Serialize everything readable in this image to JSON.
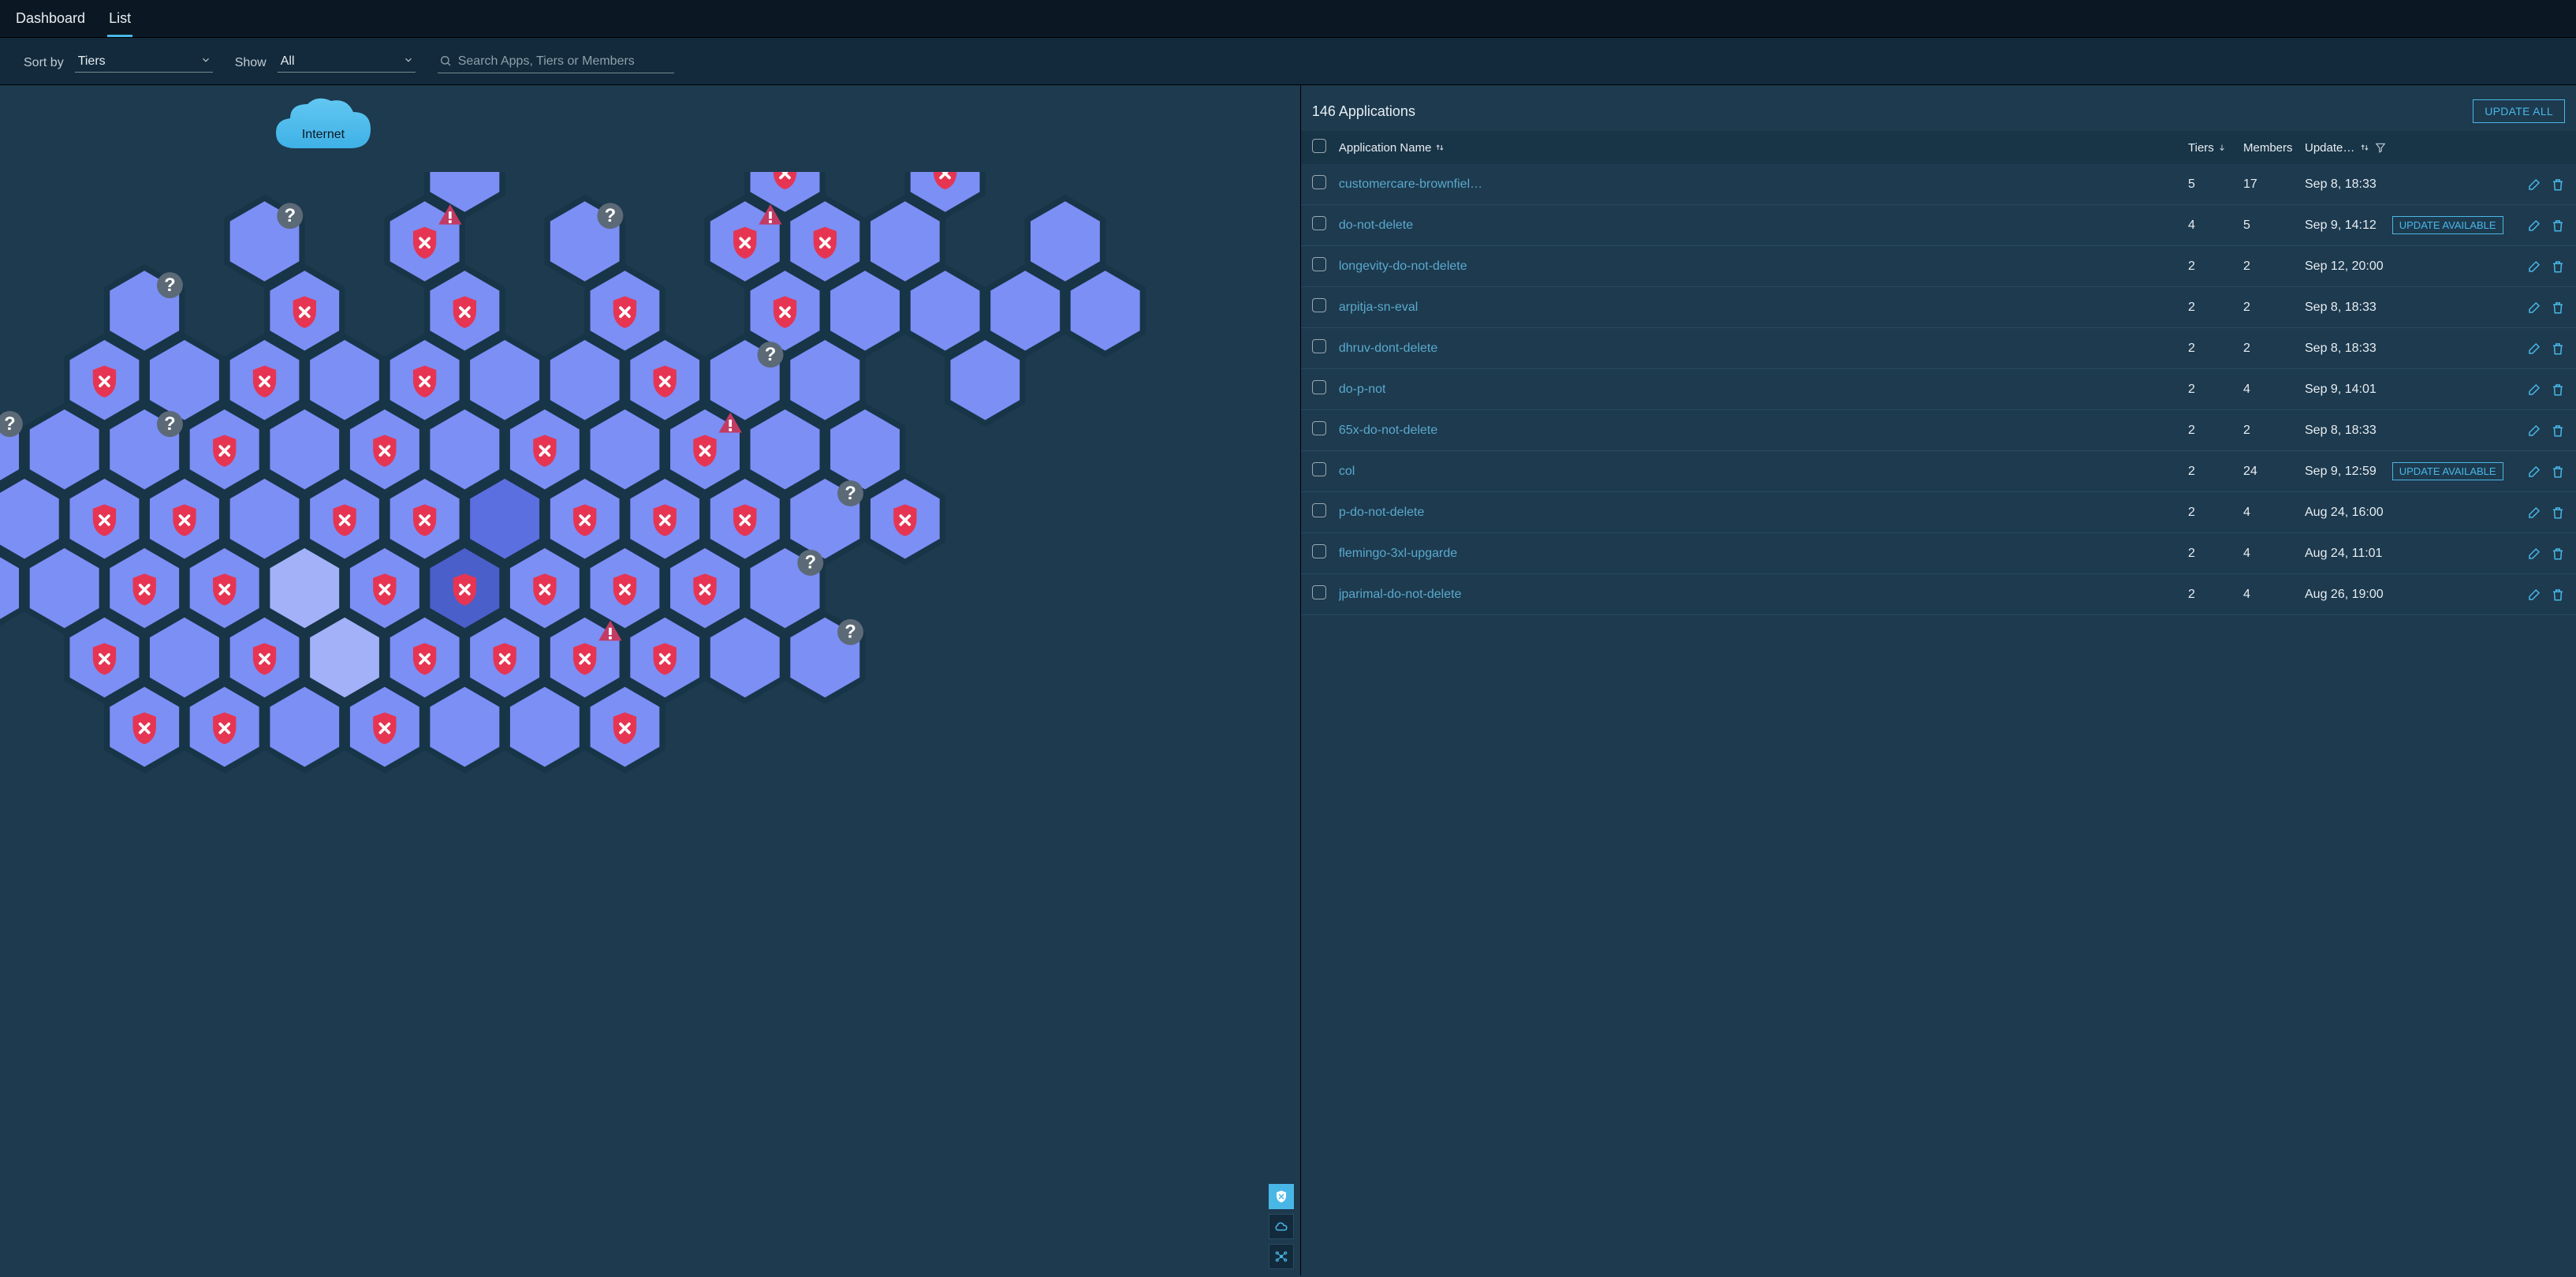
{
  "tabs": {
    "dashboard": "Dashboard",
    "list": "List",
    "active": "list"
  },
  "filters": {
    "sort_label": "Sort by",
    "sort_value": "Tiers",
    "show_label": "Show",
    "show_value": "All",
    "search_placeholder": "Search Apps, Tiers or Members"
  },
  "summary": {
    "title": "146 Applications",
    "update_all": "UPDATE ALL"
  },
  "columns": {
    "name": "Application Name",
    "tiers": "Tiers",
    "members": "Members",
    "updated": "Update…"
  },
  "update_available_label": "UPDATE AVAILABLE",
  "apps": [
    {
      "name": "customercare-brownfiel…",
      "tiers": "5",
      "members": "17",
      "updated": "Sep 8, 18:33",
      "update_available": false
    },
    {
      "name": "do-not-delete",
      "tiers": "4",
      "members": "5",
      "updated": "Sep 9, 14:12",
      "update_available": true
    },
    {
      "name": "longevity-do-not-delete",
      "tiers": "2",
      "members": "2",
      "updated": "Sep 12, 20:00",
      "update_available": false
    },
    {
      "name": "arpitja-sn-eval",
      "tiers": "2",
      "members": "2",
      "updated": "Sep 8, 18:33",
      "update_available": false
    },
    {
      "name": "dhruv-dont-delete",
      "tiers": "2",
      "members": "2",
      "updated": "Sep 8, 18:33",
      "update_available": false
    },
    {
      "name": "do-p-not",
      "tiers": "2",
      "members": "4",
      "updated": "Sep 9, 14:01",
      "update_available": false
    },
    {
      "name": "65x-do-not-delete",
      "tiers": "2",
      "members": "2",
      "updated": "Sep 8, 18:33",
      "update_available": false
    },
    {
      "name": "col",
      "tiers": "2",
      "members": "24",
      "updated": "Sep 9, 12:59",
      "update_available": true
    },
    {
      "name": "p-do-not-delete",
      "tiers": "2",
      "members": "4",
      "updated": "Aug 24, 16:00",
      "update_available": false
    },
    {
      "name": "flemingo-3xl-upgarde",
      "tiers": "2",
      "members": "4",
      "updated": "Aug 24, 11:01",
      "update_available": false
    },
    {
      "name": "jparimal-do-not-delete",
      "tiers": "2",
      "members": "4",
      "updated": "Aug 26, 19:00",
      "update_available": false
    }
  ],
  "cloud_label": "Internet",
  "hexes": [
    {
      "q": 4,
      "r": 0,
      "s": "u"
    },
    {
      "q": 8,
      "r": 0,
      "s": "e"
    },
    {
      "q": 10,
      "r": 0,
      "s": "e"
    },
    {
      "q": 1,
      "r": 1,
      "s": "u"
    },
    {
      "q": 3,
      "r": 1,
      "s": "e",
      "w": 1
    },
    {
      "q": 5,
      "r": 1,
      "s": "u"
    },
    {
      "q": 7,
      "r": 1,
      "s": "e",
      "w": 1
    },
    {
      "q": 8,
      "r": 1,
      "s": "e"
    },
    {
      "q": 9,
      "r": 1,
      "s": "n"
    },
    {
      "q": 11,
      "r": 1,
      "s": "n"
    },
    {
      "q": 0,
      "r": 2,
      "s": "u"
    },
    {
      "q": 2,
      "r": 2,
      "s": "e"
    },
    {
      "q": 4,
      "r": 2,
      "s": "e"
    },
    {
      "q": 6,
      "r": 2,
      "s": "e"
    },
    {
      "q": 8,
      "r": 2,
      "s": "e"
    },
    {
      "q": 9,
      "r": 2,
      "s": "n"
    },
    {
      "q": 10,
      "r": 2,
      "s": "n"
    },
    {
      "q": 11,
      "r": 2,
      "s": "n"
    },
    {
      "q": 12,
      "r": 2,
      "s": "n"
    },
    {
      "q": -1,
      "r": 3,
      "s": "e"
    },
    {
      "q": 0,
      "r": 3,
      "s": "n"
    },
    {
      "q": 1,
      "r": 3,
      "s": "e"
    },
    {
      "q": 2,
      "r": 3,
      "s": "n"
    },
    {
      "q": 3,
      "r": 3,
      "s": "e"
    },
    {
      "q": 4,
      "r": 3,
      "s": "n"
    },
    {
      "q": 5,
      "r": 3,
      "s": "n"
    },
    {
      "q": 6,
      "r": 3,
      "s": "e"
    },
    {
      "q": 7,
      "r": 3,
      "s": "u"
    },
    {
      "q": 8,
      "r": 3,
      "s": "n"
    },
    {
      "q": 10,
      "r": 3,
      "s": "n"
    },
    {
      "q": -2,
      "r": 4,
      "s": "u"
    },
    {
      "q": -1,
      "r": 4,
      "s": "n"
    },
    {
      "q": 0,
      "r": 4,
      "s": "u"
    },
    {
      "q": 1,
      "r": 4,
      "s": "e"
    },
    {
      "q": 2,
      "r": 4,
      "s": "n"
    },
    {
      "q": 3,
      "r": 4,
      "s": "e"
    },
    {
      "q": 4,
      "r": 4,
      "s": "n"
    },
    {
      "q": 5,
      "r": 4,
      "s": "e"
    },
    {
      "q": 6,
      "r": 4,
      "s": "n"
    },
    {
      "q": 7,
      "r": 4,
      "s": "e",
      "w": 1
    },
    {
      "q": 8,
      "r": 4,
      "s": "n"
    },
    {
      "q": 9,
      "r": 4,
      "s": "n"
    },
    {
      "q": -2,
      "r": 5,
      "s": "n"
    },
    {
      "q": -1,
      "r": 5,
      "s": "e"
    },
    {
      "q": 0,
      "r": 5,
      "s": "e"
    },
    {
      "q": 1,
      "r": 5,
      "s": "n"
    },
    {
      "q": 2,
      "r": 5,
      "s": "e"
    },
    {
      "q": 3,
      "r": 5,
      "s": "e"
    },
    {
      "q": 4,
      "r": 5,
      "s": "n",
      "d": 1
    },
    {
      "q": 5,
      "r": 5,
      "s": "e"
    },
    {
      "q": 6,
      "r": 5,
      "s": "e"
    },
    {
      "q": 7,
      "r": 5,
      "s": "e"
    },
    {
      "q": 8,
      "r": 5,
      "s": "u"
    },
    {
      "q": 9,
      "r": 5,
      "s": "e"
    },
    {
      "q": -2,
      "r": 6,
      "s": "e"
    },
    {
      "q": -1,
      "r": 6,
      "s": "n"
    },
    {
      "q": 0,
      "r": 6,
      "s": "e"
    },
    {
      "q": 1,
      "r": 6,
      "s": "e"
    },
    {
      "q": 2,
      "r": 6,
      "s": "n",
      "l": 1
    },
    {
      "q": 3,
      "r": 6,
      "s": "e"
    },
    {
      "q": 4,
      "r": 6,
      "s": "e",
      "d": 2
    },
    {
      "q": 5,
      "r": 6,
      "s": "e"
    },
    {
      "q": 6,
      "r": 6,
      "s": "e"
    },
    {
      "q": 7,
      "r": 6,
      "s": "e"
    },
    {
      "q": 8,
      "r": 6,
      "s": "u"
    },
    {
      "q": -1,
      "r": 7,
      "s": "e"
    },
    {
      "q": 0,
      "r": 7,
      "s": "n"
    },
    {
      "q": 1,
      "r": 7,
      "s": "e"
    },
    {
      "q": 2,
      "r": 7,
      "s": "n",
      "l": 1
    },
    {
      "q": 3,
      "r": 7,
      "s": "e"
    },
    {
      "q": 4,
      "r": 7,
      "s": "e"
    },
    {
      "q": 5,
      "r": 7,
      "s": "e",
      "w": 1
    },
    {
      "q": 6,
      "r": 7,
      "s": "e"
    },
    {
      "q": 7,
      "r": 7,
      "s": "n"
    },
    {
      "q": 8,
      "r": 7,
      "s": "u"
    },
    {
      "q": 0,
      "r": 8,
      "s": "e"
    },
    {
      "q": 1,
      "r": 8,
      "s": "e"
    },
    {
      "q": 2,
      "r": 8,
      "s": "n"
    },
    {
      "q": 3,
      "r": 8,
      "s": "e"
    },
    {
      "q": 4,
      "r": 8,
      "s": "n"
    },
    {
      "q": 5,
      "r": 8,
      "s": "n"
    },
    {
      "q": 6,
      "r": 8,
      "s": "e"
    }
  ]
}
